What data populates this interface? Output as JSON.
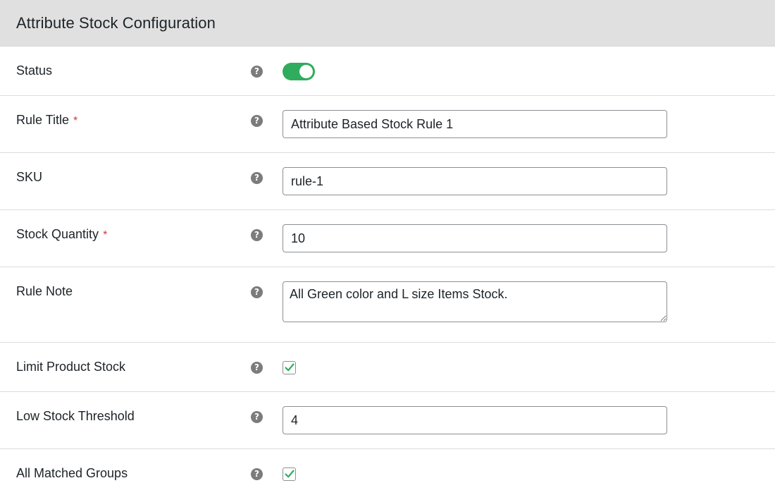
{
  "header": {
    "title": "Attribute Stock Configuration"
  },
  "required_marker": "*",
  "help_icon_glyph": "?",
  "colors": {
    "accent_green": "#2fac5d",
    "required_red": "#d63638",
    "header_bg": "#e0e0e0"
  },
  "fields": {
    "status": {
      "label": "Status",
      "enabled": true
    },
    "rule_title": {
      "label": "Rule Title",
      "value": "Attribute Based Stock Rule 1"
    },
    "sku": {
      "label": "SKU",
      "value": "rule-1"
    },
    "stock_quantity": {
      "label": "Stock Quantity",
      "value": "10"
    },
    "rule_note": {
      "label": "Rule Note",
      "value": "All Green color and L size Items Stock."
    },
    "limit_product_stock": {
      "label": "Limit Product Stock",
      "checked": true
    },
    "low_stock_threshold": {
      "label": "Low Stock Threshold",
      "value": "4"
    },
    "all_matched_groups": {
      "label": "All Matched Groups",
      "checked": true
    }
  }
}
